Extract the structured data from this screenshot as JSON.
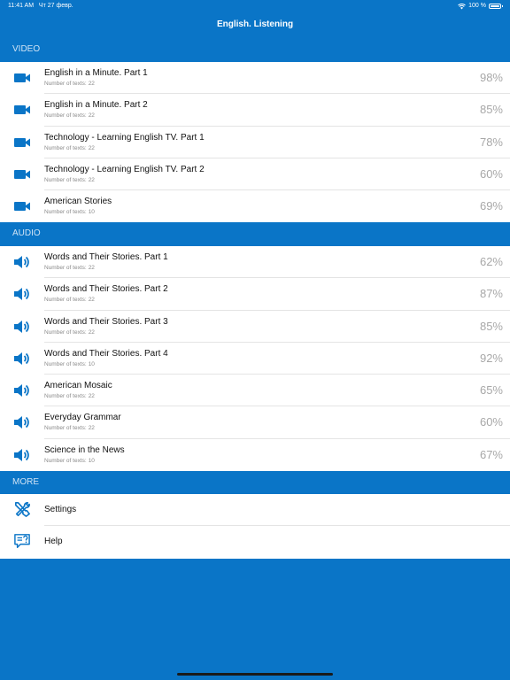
{
  "status_bar": {
    "time": "11:41 AM",
    "date": "Чт 27 февр.",
    "battery": "100 %"
  },
  "nav": {
    "title": "English. Listening"
  },
  "sections": {
    "video": {
      "header": "VIDEO",
      "items": [
        {
          "title": "English in a Minute. Part 1",
          "count_label": "Number of texts:",
          "count": "22",
          "percent": "98%"
        },
        {
          "title": "English in a Minute. Part 2",
          "count_label": "Number of texts:",
          "count": "22",
          "percent": "85%"
        },
        {
          "title": "Technology - Learning English TV. Part 1",
          "count_label": "Number of texts:",
          "count": "22",
          "percent": "78%"
        },
        {
          "title": "Technology - Learning English TV. Part 2",
          "count_label": "Number of texts:",
          "count": "22",
          "percent": "60%"
        },
        {
          "title": "American Stories",
          "count_label": "Number of texts:",
          "count": "10",
          "percent": "69%"
        }
      ]
    },
    "audio": {
      "header": "AUDIO",
      "items": [
        {
          "title": "Words and Their Stories. Part 1",
          "count_label": "Number of texts:",
          "count": "22",
          "percent": "62%"
        },
        {
          "title": "Words and Their Stories. Part 2",
          "count_label": "Number of texts:",
          "count": "22",
          "percent": "87%"
        },
        {
          "title": "Words and Their Stories. Part 3",
          "count_label": "Number of texts:",
          "count": "22",
          "percent": "85%"
        },
        {
          "title": "Words and Their Stories. Part 4",
          "count_label": "Number of texts:",
          "count": "10",
          "percent": "92%"
        },
        {
          "title": "American Mosaic",
          "count_label": "Number of texts:",
          "count": "22",
          "percent": "65%"
        },
        {
          "title": "Everyday Grammar",
          "count_label": "Number of texts:",
          "count": "22",
          "percent": "60%"
        },
        {
          "title": "Science in the News",
          "count_label": "Number of texts:",
          "count": "10",
          "percent": "67%"
        }
      ]
    },
    "more": {
      "header": "MORE",
      "items": [
        {
          "label": "Settings",
          "icon": "tools-icon"
        },
        {
          "label": "Help",
          "icon": "help-icon"
        }
      ]
    }
  },
  "colors": {
    "accent": "#0a75c7",
    "icon": "#0a75c7",
    "percent": "#a8a8a8"
  },
  "icons": {
    "video": "video-camera-icon",
    "audio": "speaker-icon",
    "status": [
      "wifi-icon",
      "battery-icon"
    ]
  }
}
